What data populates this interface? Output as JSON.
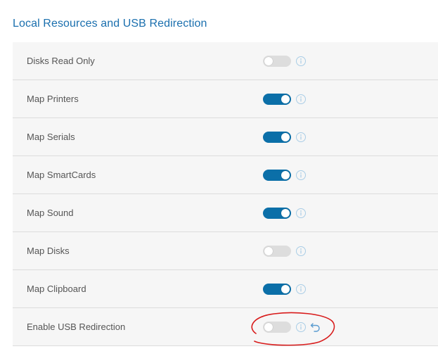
{
  "section": {
    "title": "Local Resources and USB Redirection"
  },
  "settings": [
    {
      "label": "Disks Read Only",
      "enabled": false
    },
    {
      "label": "Map Printers",
      "enabled": true
    },
    {
      "label": "Map Serials",
      "enabled": true
    },
    {
      "label": "Map SmartCards",
      "enabled": true
    },
    {
      "label": "Map Sound",
      "enabled": true
    },
    {
      "label": "Map Disks",
      "enabled": false
    },
    {
      "label": "Map Clipboard",
      "enabled": true
    },
    {
      "label": "Enable USB Redirection",
      "enabled": false,
      "modified": true
    }
  ],
  "icons": {
    "info": "info-icon",
    "undo": "undo-icon"
  },
  "colors": {
    "title": "#1a6fae",
    "toggle_on": "#0b6fa8",
    "toggle_off": "#dddddd",
    "info_icon": "#a9cde6",
    "undo_icon": "#5a9bd0",
    "annotation": "#d81b1b",
    "row_bg": "#f6f6f6"
  }
}
